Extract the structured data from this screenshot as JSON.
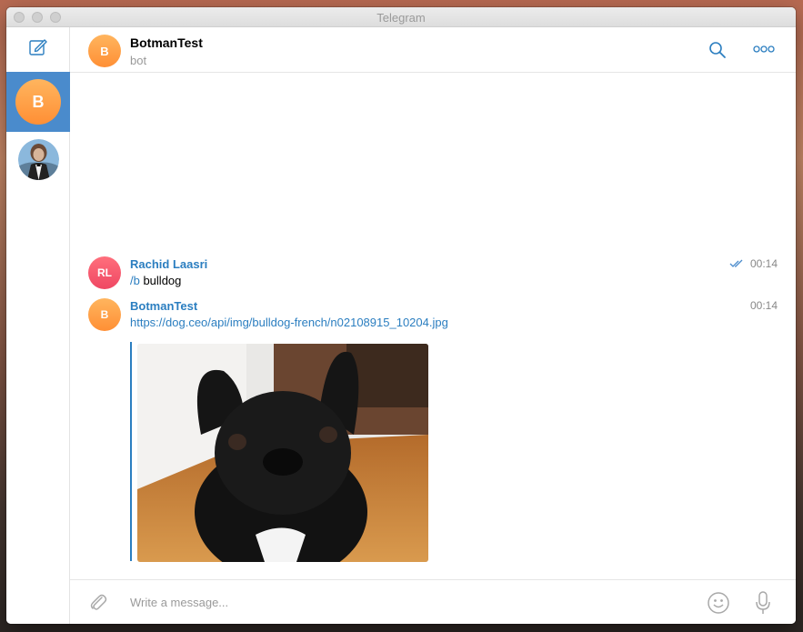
{
  "window": {
    "title": "Telegram"
  },
  "sidebar": {
    "chats": [
      {
        "initial": "B",
        "active": true
      },
      {
        "initial": "",
        "active": false
      }
    ]
  },
  "header": {
    "name": "BotmanTest",
    "status": "bot",
    "avatar_initial": "B"
  },
  "messages": [
    {
      "sender": "Rachid Laasri",
      "avatar_initials": "RL",
      "command": "/b",
      "text": " bulldog",
      "time": "00:14",
      "read": true
    },
    {
      "sender": "BotmanTest",
      "avatar_initials": "B",
      "link": "https://dog.ceo/api/img/bulldog-french/n02108915_10204.jpg",
      "time": "00:14"
    }
  ],
  "composer": {
    "placeholder": "Write a message..."
  },
  "colors": {
    "accent": "#2b7ec0",
    "active_chat": "#4a8bcc",
    "bot_avatar": "#ff9a40",
    "user_avatar": "#f04e64"
  },
  "icons": [
    "compose-icon",
    "search-icon",
    "more-icon",
    "attach-icon",
    "emoji-icon",
    "mic-icon",
    "double-check-icon"
  ]
}
